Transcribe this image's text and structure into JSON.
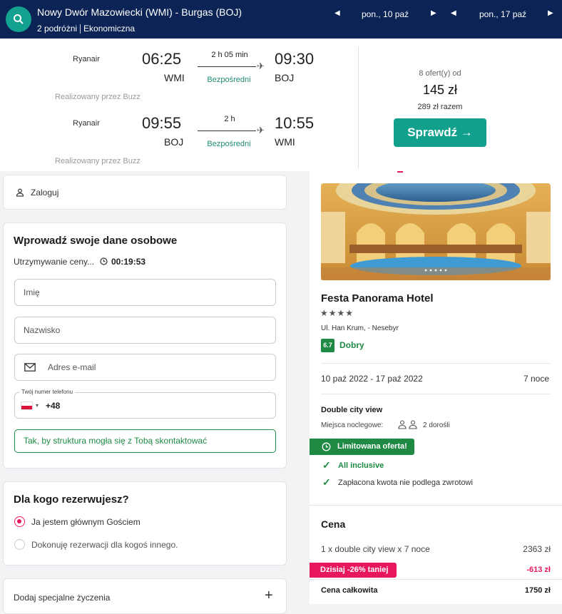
{
  "header": {
    "route": "Nowy Dwór Mazowiecki (WMI) - Burgas (BOJ)",
    "travellers": "2 podróżni",
    "cabin": "Ekonomiczna",
    "date_out": "pon., 10 paź",
    "date_back": "pon., 17 paź"
  },
  "flights": {
    "outbound": {
      "airline": "Ryanair",
      "dep_time": "06:25",
      "dep_code": "WMI",
      "arr_time": "09:30",
      "arr_code": "BOJ",
      "duration": "2 h 05 min",
      "type": "Bezpośredni",
      "operated": "Realizowany przez Buzz"
    },
    "inbound": {
      "airline": "Ryanair",
      "dep_time": "09:55",
      "dep_code": "BOJ",
      "arr_time": "10:55",
      "arr_code": "WMI",
      "duration": "2 h",
      "type": "Bezpośredni",
      "operated": "Realizowany przez Buzz"
    },
    "offers": "8 ofert(y) od",
    "price": "145 zł",
    "total": "289 zł razem",
    "check_label": "Sprawdź →"
  },
  "login": {
    "label": "Zaloguj"
  },
  "personal": {
    "title": "Wprowadź swoje dane osobowe",
    "hold_label": "Utrzymywanie ceny...",
    "timer": "00:19:53",
    "first_name_placeholder": "Imię",
    "last_name_placeholder": "Nazwisko",
    "email_placeholder": "Adres e-mail",
    "phone_label": "Twój numer telefonu",
    "phone_prefix": "+48",
    "phone_hint": "Tak, by struktura mogła się z Tobą skontaktować"
  },
  "booking_for": {
    "title": "Dla kogo rezerwujesz?",
    "option_self": "Ja jestem głównym Gościem",
    "option_other": "Dokonuję rezerwacji dla kogoś innego."
  },
  "special": {
    "label": "Dodaj specjalne życzenia"
  },
  "hotel": {
    "name": "Festa Panorama Hotel",
    "stars": "★★★★",
    "address": "Ul. Han Krum, - Nesebyr",
    "rating": "6.7",
    "rating_label": "Dobry",
    "dates": "10 paź 2022 - 17 paź 2022",
    "nights": "7 noce",
    "room": "Double city view",
    "beds_label": "Miejsca noclegowe:",
    "guests": "2 dorośli",
    "limited": "Limitowana oferta!",
    "all_inclusive": "All inclusive",
    "non_refundable": "Zapłacona kwota nie podlega zwrotowi"
  },
  "price": {
    "title": "Cena",
    "line_label": "1 x double city view x 7 noce",
    "line_value": "2363 zł",
    "discount_label": "Dzisiaj -26% taniej",
    "discount_value": "-613 zł",
    "total_label": "Cena całkowita",
    "total_value": "1750 zł"
  },
  "colors": {
    "header": "#0b2455",
    "accent": "#10a08b",
    "discount": "#e8175d",
    "radio": "#e8175d",
    "rating": "#1e8a44"
  }
}
